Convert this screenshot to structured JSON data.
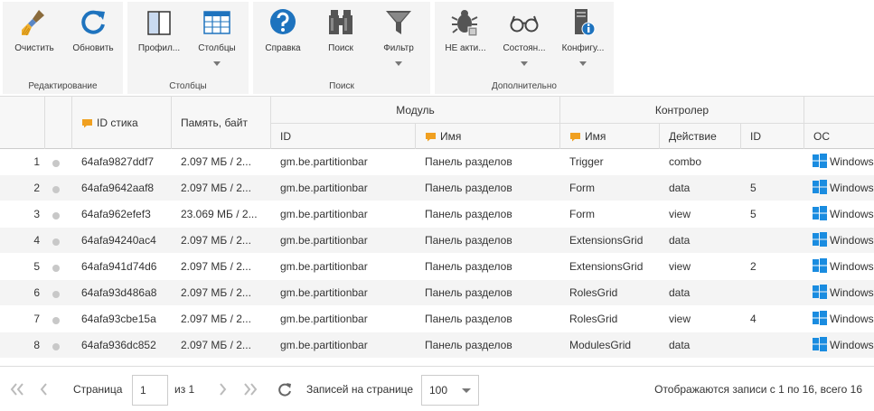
{
  "toolbar": {
    "groups": [
      {
        "label": "Редактирование",
        "buttons": [
          {
            "label": "Очистить",
            "icon": "broom-icon"
          },
          {
            "label": "Обновить",
            "icon": "refresh-icon"
          }
        ]
      },
      {
        "label": "Столбцы",
        "buttons": [
          {
            "label": "Профил...",
            "icon": "profile-panel-icon"
          },
          {
            "label": "Столбцы",
            "icon": "columns-table-icon"
          }
        ]
      },
      {
        "label": "Поиск",
        "buttons": [
          {
            "label": "Справка",
            "icon": "help-icon"
          },
          {
            "label": "Поиск",
            "icon": "binoculars-icon"
          },
          {
            "label": "Фильтр",
            "icon": "filter-icon"
          }
        ]
      },
      {
        "label": "Дополнительно",
        "buttons": [
          {
            "label": "НЕ акти...",
            "icon": "bug-icon"
          },
          {
            "label": "Состоян...",
            "icon": "glasses-icon"
          },
          {
            "label": "Конфигу...",
            "icon": "server-info-icon"
          }
        ]
      }
    ]
  },
  "grid": {
    "headers": {
      "stik_id": "ID стика",
      "memory": "Память, байт",
      "module": "Модуль",
      "module_id": "ID",
      "module_name": "Имя",
      "controller": "Контролер",
      "controller_name": "Имя",
      "action": "Действие",
      "controller_id": "ID",
      "os": "ОС"
    },
    "rows": [
      {
        "n": "1",
        "stik": "64afa9827ddf7",
        "mem": "2.097 МБ / 2...",
        "mid": "gm.be.partitionbar",
        "mname": "Панель разделов",
        "cname": "Trigger",
        "action": "combo",
        "cid": "",
        "os": "Windows"
      },
      {
        "n": "2",
        "stik": "64afa9642aaf8",
        "mem": "2.097 МБ / 2...",
        "mid": "gm.be.partitionbar",
        "mname": "Панель разделов",
        "cname": "Form",
        "action": "data",
        "cid": "5",
        "os": "Windows"
      },
      {
        "n": "3",
        "stik": "64afa962efef3",
        "mem": "23.069 МБ / 2...",
        "mid": "gm.be.partitionbar",
        "mname": "Панель разделов",
        "cname": "Form",
        "action": "view",
        "cid": "5",
        "os": "Windows"
      },
      {
        "n": "4",
        "stik": "64afa94240ac4",
        "mem": "2.097 МБ / 2...",
        "mid": "gm.be.partitionbar",
        "mname": "Панель разделов",
        "cname": "ExtensionsGrid",
        "action": "data",
        "cid": "",
        "os": "Windows"
      },
      {
        "n": "5",
        "stik": "64afa941d74d6",
        "mem": "2.097 МБ / 2...",
        "mid": "gm.be.partitionbar",
        "mname": "Панель разделов",
        "cname": "ExtensionsGrid",
        "action": "view",
        "cid": "2",
        "os": "Windows"
      },
      {
        "n": "6",
        "stik": "64afa93d486a8",
        "mem": "2.097 МБ / 2...",
        "mid": "gm.be.partitionbar",
        "mname": "Панель разделов",
        "cname": "RolesGrid",
        "action": "data",
        "cid": "",
        "os": "Windows"
      },
      {
        "n": "7",
        "stik": "64afa93cbe15a",
        "mem": "2.097 МБ / 2...",
        "mid": "gm.be.partitionbar",
        "mname": "Панель разделов",
        "cname": "RolesGrid",
        "action": "view",
        "cid": "4",
        "os": "Windows"
      },
      {
        "n": "8",
        "stik": "64afa936dc852",
        "mem": "2.097 МБ / 2...",
        "mid": "gm.be.partitionbar",
        "mname": "Панель разделов",
        "cname": "ModulesGrid",
        "action": "data",
        "cid": "",
        "os": "Windows"
      }
    ]
  },
  "pager": {
    "page_label": "Страница",
    "page_value": "1",
    "of_label": "из 1",
    "per_page_label": "Записей на странице",
    "per_page_value": "100",
    "summary": "Отображаются записи с 1 по 16, всего 16"
  },
  "colors": {
    "accent_blue": "#1e73be",
    "windows_blue": "#1a8ce0",
    "chat_orange": "#f0a020"
  }
}
